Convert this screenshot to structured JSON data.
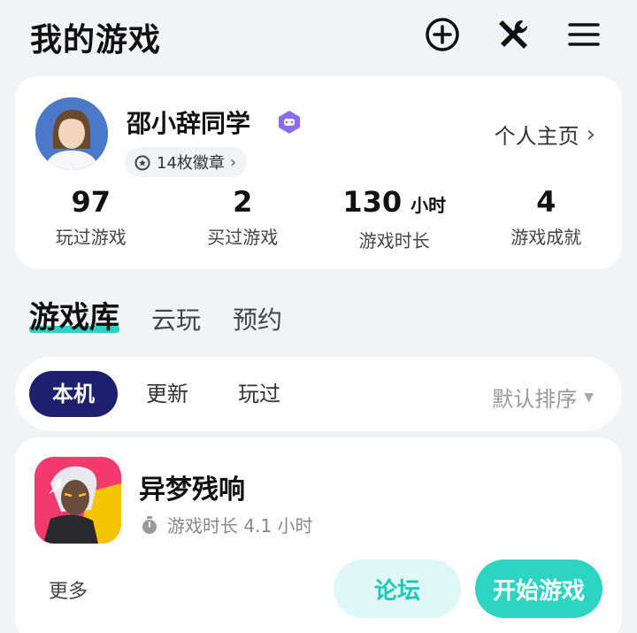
{
  "header": {
    "title": "我的游戏",
    "icons": [
      "add-circle-icon",
      "tools-icon",
      "menu-icon"
    ]
  },
  "profile": {
    "name": "邵小辞同学",
    "badges_text": "14枚徽章",
    "homepage_label": "个人主页",
    "stats": [
      {
        "value": "97",
        "unit": "",
        "label": "玩过游戏"
      },
      {
        "value": "2",
        "unit": "",
        "label": "买过游戏"
      },
      {
        "value": "130",
        "unit": "小时",
        "label": "游戏时长"
      },
      {
        "value": "4",
        "unit": "",
        "label": "游戏成就"
      }
    ]
  },
  "library": {
    "tabs": [
      "游戏库",
      "云玩",
      "预约"
    ],
    "active_tab": "游戏库"
  },
  "filters": {
    "chips": [
      "本机",
      "更新",
      "玩过"
    ],
    "active_chip": "本机",
    "sort_label": "默认排序"
  },
  "game": {
    "title": "异梦残响",
    "playtime": "游戏时长 4.1 小时",
    "more_label": "更多",
    "forum_label": "论坛",
    "start_label": "开始游戏"
  },
  "colors": {
    "accent": "#2dd4c2",
    "accent_light": "#dff8f5",
    "chip_active": "#1e1f6e",
    "vip": "#8a6cf0"
  }
}
